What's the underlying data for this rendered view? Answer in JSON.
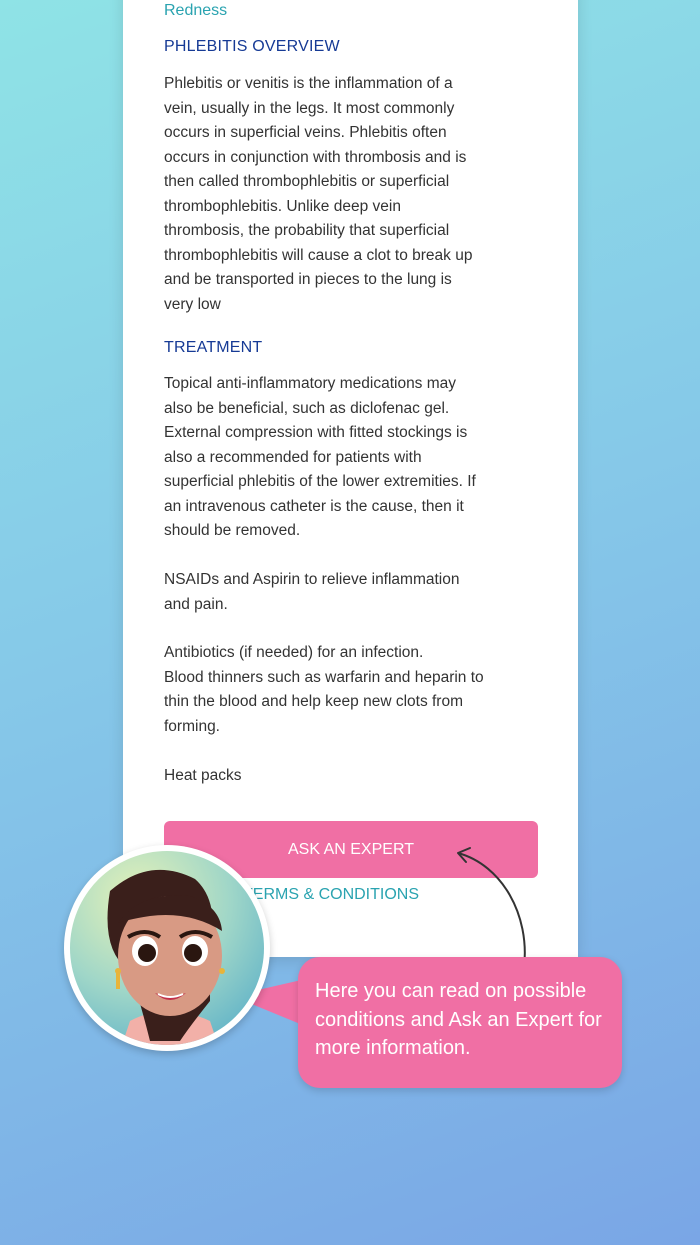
{
  "card": {
    "redness_label": "Redness",
    "sections": [
      {
        "heading": "PHLEBITIS OVERVIEW",
        "body": "Phlebitis or venitis is the inflammation of a\nvein, usually in the legs. It most commonly\noccurs in superficial veins. Phlebitis often\noccurs in conjunction with thrombosis and is\nthen called thrombophlebitis or superficial\nthrombophlebitis. Unlike deep vein\nthrombosis, the probability that superficial\nthrombophlebitis will cause a clot to break up\nand be transported in pieces to the lung is\nvery low"
      },
      {
        "heading": "TREATMENT",
        "paragraphs": [
          "Topical anti-inflammatory medications may\nalso be beneficial, such as diclofenac gel.\nExternal compression with fitted stockings is\nalso a recommended for patients with\nsuperficial phlebitis of the lower extremities. If\nan intravenous catheter is the cause, then it\nshould be removed.",
          "NSAIDs and Aspirin to relieve inflammation\nand pain.",
          "Antibiotics (if needed) for an infection.\nBlood thinners such as warfarin and heparin to\nthin the blood and help keep new clots from\nforming.",
          "Heat packs"
        ]
      }
    ],
    "ask_button_label": "ASK AN EXPERT",
    "terms_link_label": "TERMS & CONDITIONS"
  },
  "tooltip": {
    "text": "Here you can read on possible conditions and Ask an Expert for more information."
  },
  "colors": {
    "accent_pink": "#f06fa4",
    "heading_blue": "#163a95",
    "link_teal": "#2aa3b0"
  },
  "icons": {
    "avatar": "doctor-avatar-icon",
    "arrow": "curved-arrow-icon"
  }
}
